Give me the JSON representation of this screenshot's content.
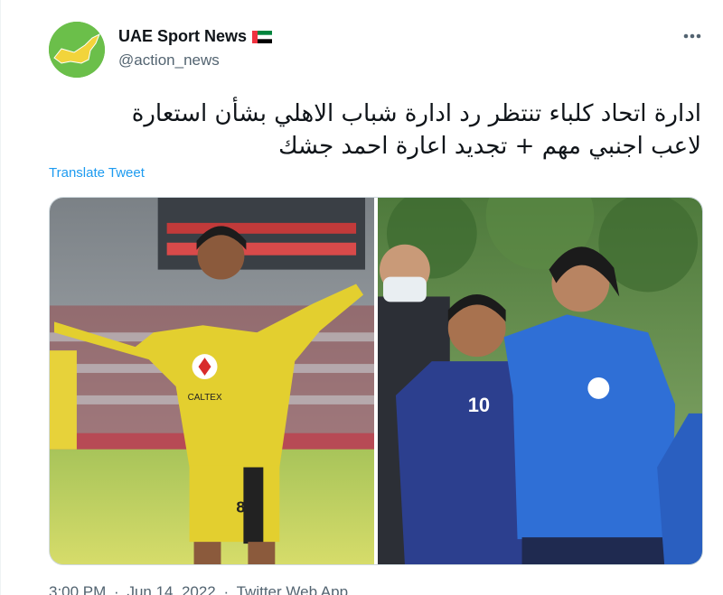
{
  "author": {
    "name": "UAE Sport News",
    "handle": "@action_news",
    "avatar_icon": "uae-map-icon",
    "flag_icon": "uae-flag-icon"
  },
  "more_icon": "more-horizontal-icon",
  "tweet": {
    "lines": [
      "ادارة اتحاد كلباء تنتظر رد ادارة شباب الاهلي بشأن استعارة",
      "لاعب اجنبي مهم + تجديد اعارة احمد جشك"
    ],
    "translate_label": "Translate Tweet"
  },
  "media": {
    "photo_left": {
      "description": "player-in-yellow-kit",
      "jersey_number": "8",
      "sponsor": "CALTEX"
    },
    "photo_right": {
      "description": "two-players-in-blue-kit",
      "jersey_number": "10"
    }
  },
  "meta": {
    "time": "3:00 PM",
    "separator": "·",
    "date": "Jun 14, 2022",
    "source": "Twitter Web App"
  },
  "colors": {
    "link": "#1d9bf0",
    "secondary_text": "#536471",
    "avatar_bg": "#6bbf4a"
  }
}
